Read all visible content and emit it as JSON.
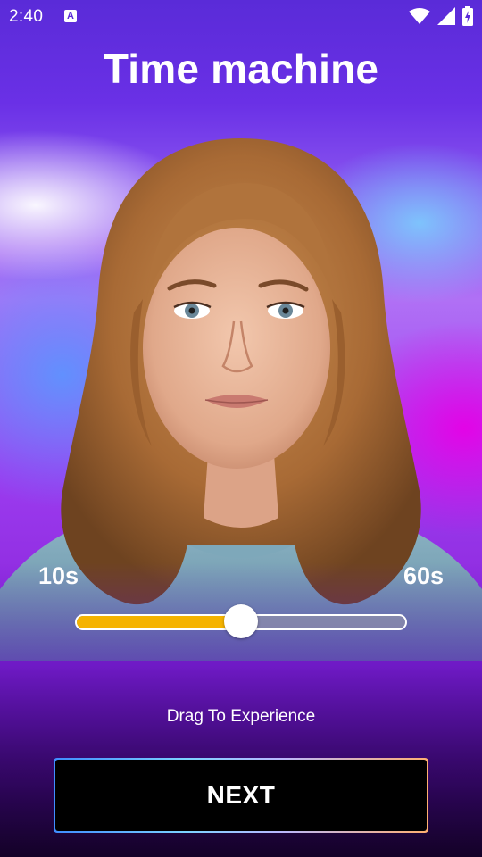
{
  "status_bar": {
    "time": "2:40",
    "notification_icon": "a-icon",
    "icons": [
      "wifi-icon",
      "signal-icon",
      "battery-charging-icon"
    ]
  },
  "header": {
    "title": "Time machine"
  },
  "slider": {
    "min_label": "10s",
    "max_label": "60s",
    "value_fraction": 0.5,
    "fill_color": "#f5b300"
  },
  "hint": {
    "text": "Drag To Experience"
  },
  "actions": {
    "next_label": "NEXT"
  }
}
